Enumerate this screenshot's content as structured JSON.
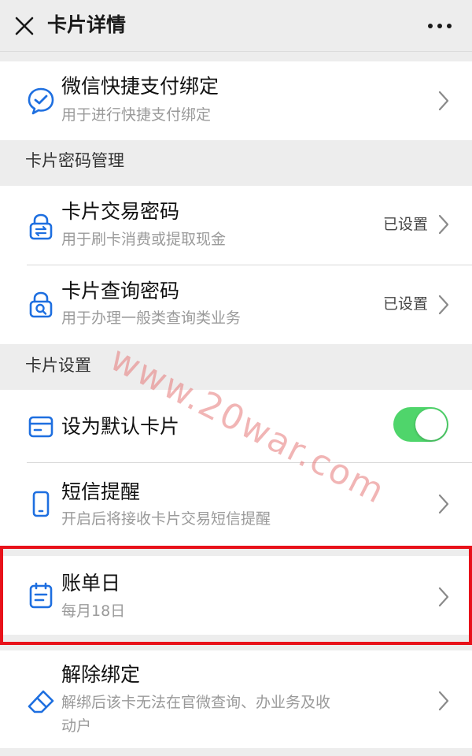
{
  "header": {
    "title": "卡片详情"
  },
  "payment": {
    "title": "微信快捷支付绑定",
    "subtitle": "用于进行快捷支付绑定"
  },
  "password_section": {
    "label": "卡片密码管理",
    "items": [
      {
        "title": "卡片交易密码",
        "subtitle": "用于刷卡消费或提取现金",
        "status": "已设置"
      },
      {
        "title": "卡片查询密码",
        "subtitle": "用于办理一般类查询类业务",
        "status": "已设置"
      }
    ]
  },
  "settings_section": {
    "label": "卡片设置",
    "default_card": {
      "title": "设为默认卡片",
      "enabled": true
    },
    "sms": {
      "title": "短信提醒",
      "subtitle": "开启后将接收卡片交易短信提醒"
    },
    "bill_day": {
      "title": "账单日",
      "subtitle": "每月18日"
    },
    "unbind": {
      "title": "解除绑定",
      "subtitle_line1": "解绑后该卡无法在官微查询、办业务及收",
      "subtitle_line2": "动户"
    }
  },
  "watermark": "www.20war.com",
  "colors": {
    "icon_blue": "#1e6fe0",
    "toggle_green": "#4fd56b",
    "highlight_red": "#e8121a"
  }
}
